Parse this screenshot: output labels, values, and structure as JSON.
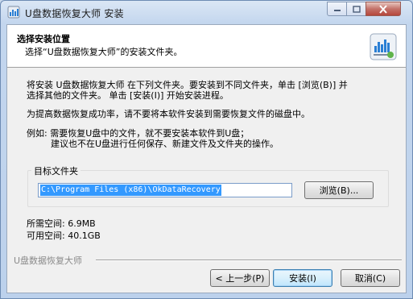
{
  "window": {
    "title": "U盘数据恢复大师 安装",
    "app_icon": "installer-bars-icon",
    "controls": {
      "minimize": "minimize-icon",
      "maximize": "maximize-icon",
      "close": "close-icon"
    }
  },
  "header": {
    "title": "选择安装位置",
    "subtitle": "选择“U盘数据恢复大师”的安装文件夹。",
    "logo": "installer-chart-logo-icon"
  },
  "body": {
    "intro_line1": "将安装 U盘数据恢复大师 在下列文件夹。要安装到不同文件夹，单击 [浏览(B)] 并",
    "intro_line2": "选择其他的文件夹。 单击 [安装(I)] 开始安装进程。",
    "tip": "为提高数据恢复成功率，请不要将本软件安装到需要恢复文件的磁盘中。",
    "example_line1": "例如: 需要恢复U盘中的文件，就不要安装本软件到U盘；",
    "example_line2": "建议也不在U盘进行任何保存、新建文件及文件夹的操作。"
  },
  "destination": {
    "label": "目标文件夹",
    "path": "C:\\Program Files (x86)\\OkDataRecovery",
    "browse_label": "浏览(B)..."
  },
  "space": {
    "required": "所需空间: 6.9MB",
    "available": "可用空间: 40.1GB"
  },
  "branding": "U盘数据恢复大师",
  "buttons": {
    "back": "< 上一步(P)",
    "install": "安装(I)",
    "cancel": "取消(C)"
  },
  "colors": {
    "selection": "#3399ff",
    "title_bar": "#c3d6ee",
    "close_button": "#c4726a"
  }
}
